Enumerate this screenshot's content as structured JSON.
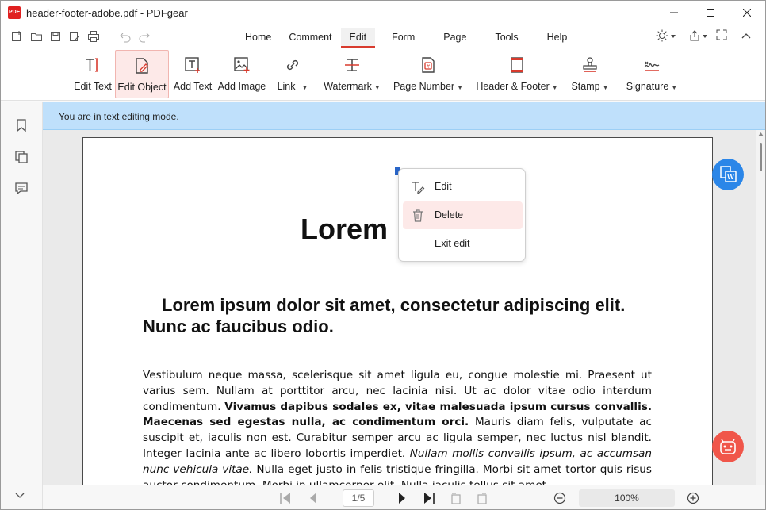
{
  "window": {
    "title": "header-footer-adobe.pdf - PDFgear",
    "logo_text": "PDF"
  },
  "menu": {
    "tabs": [
      {
        "label": "Home"
      },
      {
        "label": "Comment"
      },
      {
        "label": "Edit"
      },
      {
        "label": "Form"
      },
      {
        "label": "Page"
      },
      {
        "label": "Tools"
      },
      {
        "label": "Help"
      }
    ],
    "active_tab": "Edit"
  },
  "ribbon": {
    "items": [
      {
        "label": "Edit Text",
        "icon": "edit-text-icon"
      },
      {
        "label": "Edit Object",
        "icon": "edit-object-icon",
        "active": true
      },
      {
        "label": "Add Text",
        "icon": "add-text-icon"
      },
      {
        "label": "Add Image",
        "icon": "add-image-icon"
      },
      {
        "label": "Link",
        "icon": "link-icon"
      },
      {
        "label": "Watermark",
        "icon": "watermark-icon"
      },
      {
        "label": "Page Number",
        "icon": "page-number-icon"
      },
      {
        "label": "Header & Footer",
        "icon": "header-footer-icon"
      },
      {
        "label": "Stamp",
        "icon": "stamp-icon"
      },
      {
        "label": "Signature",
        "icon": "signature-icon"
      }
    ]
  },
  "banner": {
    "text": "You are in text editing mode."
  },
  "document": {
    "title": "Lorem",
    "heading": "Lorem ipsum dolor sit amet, consectetur adipiscing elit. Nunc ac faucibus odio.",
    "body": {
      "p1": "Vestibulum neque massa, scelerisque sit amet ligula eu, congue molestie mi. Praesent ut varius sem. Nullam at porttitor arcu, nec lacinia nisi. Ut ac dolor vitae odio interdum condimentum. ",
      "p1_bold": "Vivamus dapibus sodales ex, vitae malesuada ipsum cursus convallis. Maecenas sed egestas nulla, ac condimentum orci.",
      "p2": " Mauris diam felis, vulputate ac suscipit et, iaculis non est. Curabitur semper arcu ac ligula semper, nec luctus nisl blandit. Integer lacinia ante ac libero lobortis imperdiet. ",
      "p2_italic": "Nullam mollis convallis ipsum, ac accumsan nunc vehicula vitae.",
      "p3": " Nulla eget justo in felis tristique fringilla. Morbi sit amet tortor quis risus auctor condimentum. Morbi in ullamcorper elit. Nulla iaculis tellus sit amet"
    }
  },
  "context_menu": {
    "items": [
      {
        "label": "Edit",
        "icon": "edit-pen-icon"
      },
      {
        "label": "Delete",
        "icon": "trash-icon"
      },
      {
        "label": "Exit edit",
        "icon": ""
      }
    ]
  },
  "navigation": {
    "page_indicator": "1/5",
    "zoom": "100%"
  },
  "colors": {
    "accent": "#d83b2e",
    "banner": "#bfe0fb",
    "active_ribbon_bg": "#fde9e8",
    "fab_blue": "#2b86e8",
    "fab_red": "#f0564a"
  }
}
